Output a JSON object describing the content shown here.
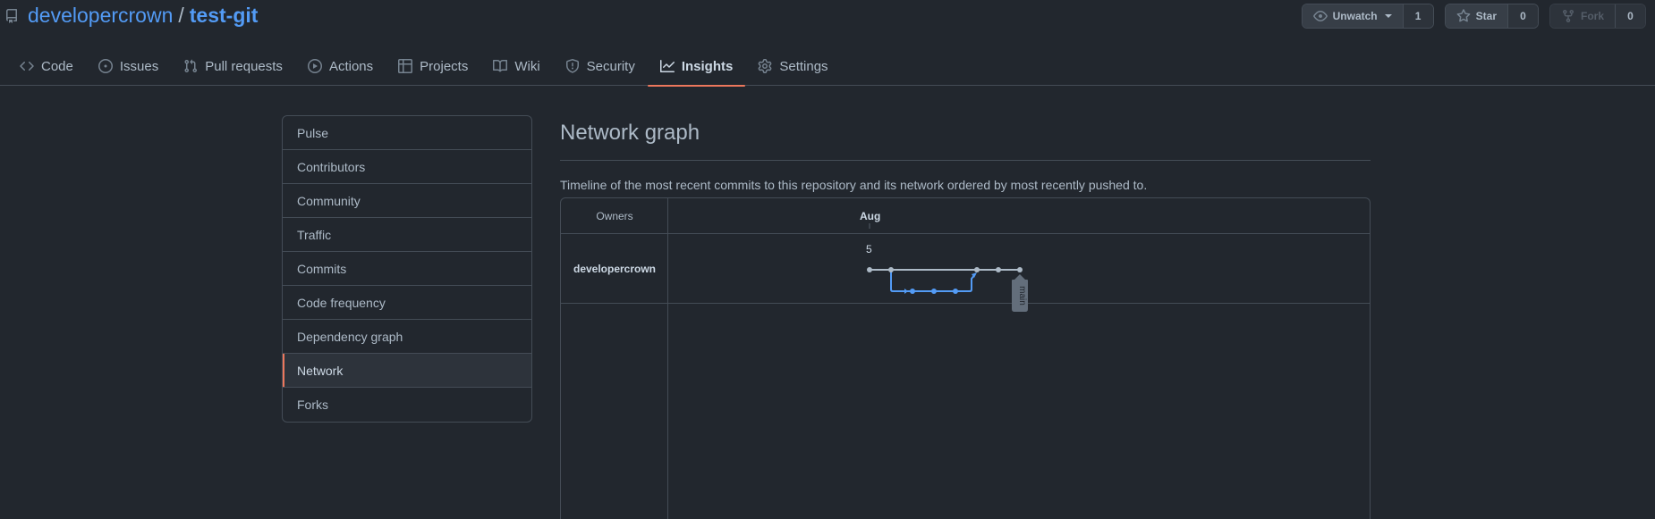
{
  "repo": {
    "owner": "developercrown",
    "separator": "/",
    "name": "test-git"
  },
  "actions": {
    "watch": {
      "label": "Unwatch",
      "count": "1"
    },
    "star": {
      "label": "Star",
      "count": "0"
    },
    "fork": {
      "label": "Fork",
      "count": "0"
    }
  },
  "tabs": [
    {
      "label": "Code",
      "icon": "code-icon"
    },
    {
      "label": "Issues",
      "icon": "issue-icon"
    },
    {
      "label": "Pull requests",
      "icon": "pull-request-icon"
    },
    {
      "label": "Actions",
      "icon": "play-icon"
    },
    {
      "label": "Projects",
      "icon": "table-icon"
    },
    {
      "label": "Wiki",
      "icon": "book-icon"
    },
    {
      "label": "Security",
      "icon": "shield-icon"
    },
    {
      "label": "Insights",
      "icon": "graph-icon",
      "active": true
    },
    {
      "label": "Settings",
      "icon": "gear-icon"
    }
  ],
  "menu": [
    {
      "label": "Pulse"
    },
    {
      "label": "Contributors"
    },
    {
      "label": "Community"
    },
    {
      "label": "Traffic"
    },
    {
      "label": "Commits"
    },
    {
      "label": "Code frequency"
    },
    {
      "label": "Dependency graph"
    },
    {
      "label": "Network",
      "selected": true
    },
    {
      "label": "Forks"
    }
  ],
  "page": {
    "title": "Network graph",
    "description": "Timeline of the most recent commits to this repository and its network ordered by most recently pushed to."
  },
  "network": {
    "owners_header": "Owners",
    "month": "Aug",
    "day": "5",
    "owner": "developercrown",
    "branch_label": "main",
    "colors": {
      "main": "#adbac7",
      "branch": "#539bf5",
      "accent": "#ec775c"
    }
  }
}
